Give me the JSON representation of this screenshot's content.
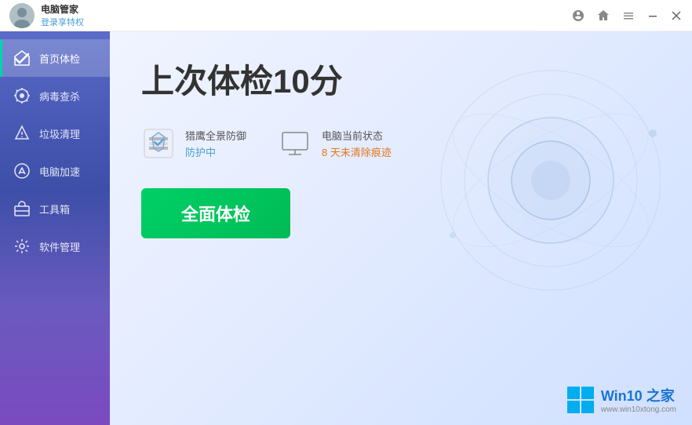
{
  "titleBar": {
    "appName": "电脑管家",
    "loginText": "登录享特权",
    "icons": {
      "skin": "🎨",
      "home": "🏠",
      "menu": "≡",
      "minimize": "－",
      "close": "×"
    }
  },
  "sidebar": {
    "items": [
      {
        "id": "home-check",
        "label": "首页体检",
        "active": true
      },
      {
        "id": "virus-scan",
        "label": "病毒查杀",
        "active": false
      },
      {
        "id": "trash-clean",
        "label": "垃圾清理",
        "active": false
      },
      {
        "id": "pc-boost",
        "label": "电脑加速",
        "active": false
      },
      {
        "id": "toolbox",
        "label": "工具箱",
        "active": false
      },
      {
        "id": "software-mgmt",
        "label": "软件管理",
        "active": false
      }
    ]
  },
  "content": {
    "mainTitle": "上次体检10分",
    "statusCards": [
      {
        "id": "anti-virus",
        "title": "猎鹰全景防御",
        "value": "防护中",
        "valueStyle": "blue"
      },
      {
        "id": "pc-status",
        "title": "电脑当前状态",
        "value": "8 天未清除痕迹",
        "valueStyle": "orange"
      }
    ],
    "actionButton": "全面体检"
  },
  "watermark": {
    "title": "Win10 之家",
    "url": "www.win10xtong.com"
  }
}
